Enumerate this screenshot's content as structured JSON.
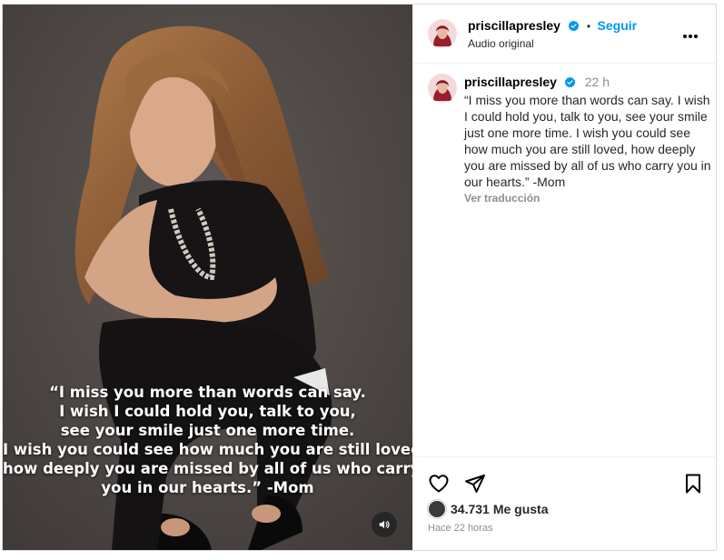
{
  "post": {
    "overlay_lines": [
      "“I miss you more than words can say.",
      "I wish I could hold you, talk to you,",
      "see your smile just one more time.",
      "I wish you could see how much you are still loved,",
      "how deeply you are missed by all of us who carry",
      "you in our hearts.” -Mom"
    ]
  },
  "header": {
    "username": "priscillapresley",
    "separator": "•",
    "follow_label": "Seguir",
    "audio_label": "Audio original",
    "more_label": "•••"
  },
  "caption": {
    "username": "priscillapresley",
    "time": "22 h",
    "text": "“I miss you more than words can say. I wish I could hold you, talk to you, see your smile just one more time. I wish you could see how much you are still loved, how deeply you are missed by all of us who carry you in our hearts.” -Mom",
    "translate_label": "Ver traducción"
  },
  "footer": {
    "likes_count": "34.731",
    "likes_label": "Me gusta",
    "posted_ago": "Hace 22 horas"
  },
  "icons": {
    "like": "heart-icon",
    "share": "paper-plane-icon",
    "save": "bookmark-icon",
    "audio": "speaker-icon",
    "verified": "verified-badge-icon"
  },
  "colors": {
    "follow": "#0095f6",
    "verified": "#0095f6",
    "muted": "#8e8e8e"
  }
}
